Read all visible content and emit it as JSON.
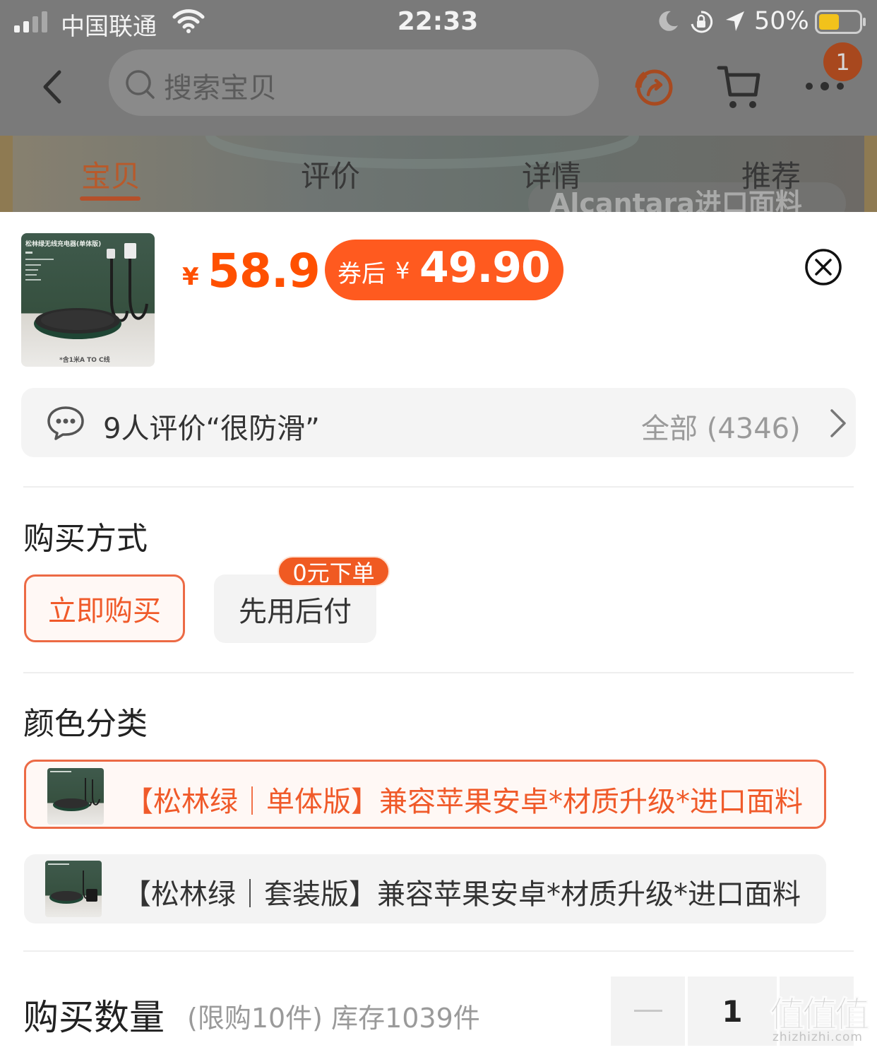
{
  "status_bar": {
    "carrier": "中国联通",
    "time": "22:33",
    "battery_percent": "50%"
  },
  "header": {
    "search_placeholder": "搜索宝贝",
    "cart_badge_count": "1"
  },
  "tabs": [
    {
      "label": "宝贝",
      "active": true
    },
    {
      "label": "评价",
      "active": false
    },
    {
      "label": "详情",
      "active": false
    },
    {
      "label": "推荐",
      "active": false
    }
  ],
  "background_banner_text": "Alcantara进口面料",
  "product": {
    "price_symbol": "¥",
    "price": "58.9",
    "coupon_label": "券后",
    "coupon_symbol": "¥",
    "coupon_price": "49.90",
    "thumb_text": {
      "title": "松林绿无线充电器(单体版)",
      "caption": "*含1米A TO C线"
    }
  },
  "reviews": {
    "summary": "9人评价“很防滑”",
    "all_label": "全部 (4346)"
  },
  "purchase_method": {
    "title": "购买方式",
    "options": [
      {
        "label": "立即购买",
        "selected": true
      },
      {
        "label": "先用后付",
        "selected": false,
        "badge": "0元下单"
      }
    ]
  },
  "color_category": {
    "title": "颜色分类",
    "options": [
      {
        "label": "【松林绿｜单体版】兼容苹果安卓*材质升级*进口面料",
        "selected": true
      },
      {
        "label": "【松林绿｜套装版】兼容苹果安卓*材质升级*进口面料",
        "selected": false
      }
    ]
  },
  "quantity": {
    "title": "购买数量",
    "limit_text": "(限购10件) 库存1039件",
    "value": "1"
  },
  "watermark": {
    "main": "值值值",
    "sub": "zhizhizhi.com"
  },
  "colors": {
    "accent": "#ff5000",
    "selected_border": "#ec6a45",
    "coupon_bg": "#ff5a1f"
  }
}
